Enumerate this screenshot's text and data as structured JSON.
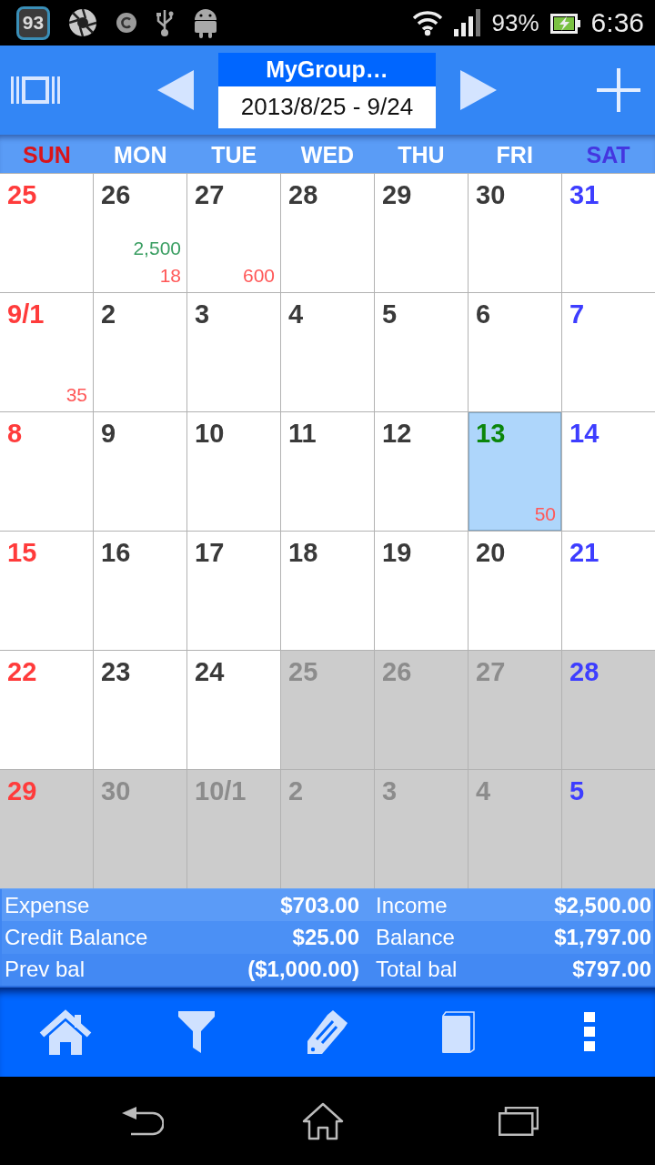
{
  "status_bar": {
    "badge": "93",
    "battery": "93%",
    "time": "6:36"
  },
  "header": {
    "group": "MyGroup…",
    "date_range": "2013/8/25 - 9/24"
  },
  "weekdays": [
    {
      "label": "SUN",
      "kind": "sun"
    },
    {
      "label": "MON",
      "kind": "weekday"
    },
    {
      "label": "TUE",
      "kind": "weekday"
    },
    {
      "label": "WED",
      "kind": "weekday"
    },
    {
      "label": "THU",
      "kind": "weekday"
    },
    {
      "label": "FRI",
      "kind": "weekday"
    },
    {
      "label": "SAT",
      "kind": "sat"
    }
  ],
  "weeks": [
    {
      "days": [
        {
          "label": "25",
          "in_range": true,
          "selected": false
        },
        {
          "label": "26",
          "in_range": true,
          "selected": false,
          "amounts": [
            {
              "text": "2,500",
              "kind": "income"
            },
            {
              "text": "18",
              "kind": "expense"
            }
          ]
        },
        {
          "label": "27",
          "in_range": true,
          "selected": false,
          "amounts": [
            {
              "text": "600",
              "kind": "expense"
            }
          ]
        },
        {
          "label": "28",
          "in_range": true,
          "selected": false
        },
        {
          "label": "29",
          "in_range": true,
          "selected": false
        },
        {
          "label": "30",
          "in_range": true,
          "selected": false
        },
        {
          "label": "31",
          "in_range": true,
          "selected": false
        }
      ]
    },
    {
      "days": [
        {
          "label": "9/1",
          "in_range": true,
          "selected": false,
          "amounts": [
            {
              "text": "35",
              "kind": "expense"
            }
          ]
        },
        {
          "label": "2",
          "in_range": true,
          "selected": false
        },
        {
          "label": "3",
          "in_range": true,
          "selected": false
        },
        {
          "label": "4",
          "in_range": true,
          "selected": false
        },
        {
          "label": "5",
          "in_range": true,
          "selected": false
        },
        {
          "label": "6",
          "in_range": true,
          "selected": false
        },
        {
          "label": "7",
          "in_range": true,
          "selected": false
        }
      ]
    },
    {
      "days": [
        {
          "label": "8",
          "in_range": true,
          "selected": false
        },
        {
          "label": "9",
          "in_range": true,
          "selected": false
        },
        {
          "label": "10",
          "in_range": true,
          "selected": false
        },
        {
          "label": "11",
          "in_range": true,
          "selected": false
        },
        {
          "label": "12",
          "in_range": true,
          "selected": false
        },
        {
          "label": "13",
          "in_range": true,
          "selected": true,
          "amounts": [
            {
              "text": "50",
              "kind": "expense"
            }
          ]
        },
        {
          "label": "14",
          "in_range": true,
          "selected": false
        }
      ]
    },
    {
      "days": [
        {
          "label": "15",
          "in_range": true,
          "selected": false
        },
        {
          "label": "16",
          "in_range": true,
          "selected": false
        },
        {
          "label": "17",
          "in_range": true,
          "selected": false
        },
        {
          "label": "18",
          "in_range": true,
          "selected": false
        },
        {
          "label": "19",
          "in_range": true,
          "selected": false
        },
        {
          "label": "20",
          "in_range": true,
          "selected": false
        },
        {
          "label": "21",
          "in_range": true,
          "selected": false
        }
      ]
    },
    {
      "days": [
        {
          "label": "22",
          "in_range": true,
          "selected": false
        },
        {
          "label": "23",
          "in_range": true,
          "selected": false
        },
        {
          "label": "24",
          "in_range": true,
          "selected": false
        },
        {
          "label": "25",
          "in_range": false,
          "selected": false
        },
        {
          "label": "26",
          "in_range": false,
          "selected": false
        },
        {
          "label": "27",
          "in_range": false,
          "selected": false
        },
        {
          "label": "28",
          "in_range": false,
          "selected": false
        }
      ]
    },
    {
      "days": [
        {
          "label": "29",
          "in_range": false,
          "selected": false
        },
        {
          "label": "30",
          "in_range": false,
          "selected": false
        },
        {
          "label": "10/1",
          "in_range": false,
          "selected": false
        },
        {
          "label": "2",
          "in_range": false,
          "selected": false
        },
        {
          "label": "3",
          "in_range": false,
          "selected": false
        },
        {
          "label": "4",
          "in_range": false,
          "selected": false
        },
        {
          "label": "5",
          "in_range": false,
          "selected": false
        }
      ]
    }
  ],
  "summary": [
    {
      "cells": [
        {
          "label": "Expense",
          "value": "$703.00"
        },
        {
          "label": "Income",
          "value": "$2,500.00"
        }
      ]
    },
    {
      "cells": [
        {
          "label": "Credit Balance",
          "value": "$25.00"
        },
        {
          "label": "Balance",
          "value": "$1,797.00"
        }
      ]
    },
    {
      "cells": [
        {
          "label": "Prev bal",
          "value": "($1,000.00)"
        },
        {
          "label": "Total bal",
          "value": "$797.00"
        }
      ]
    }
  ]
}
